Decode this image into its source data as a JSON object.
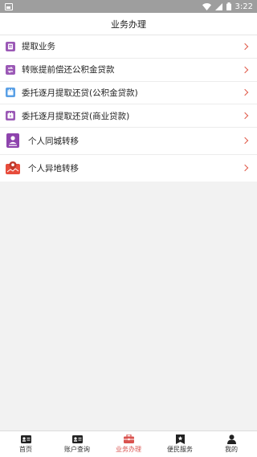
{
  "status_bar": {
    "time": "3:22"
  },
  "header": {
    "title": "业务办理"
  },
  "menu": [
    {
      "label": "提取业务",
      "icon": "withdraw-icon",
      "color": "#9b59b6"
    },
    {
      "label": "转账提前偿还公积金贷款",
      "icon": "transfer-repay-icon",
      "color": "#9b59b6"
    },
    {
      "label": "委托逐月提取还贷(公积金贷款)",
      "icon": "monthly-fund-icon",
      "color": "#5aa0e6"
    },
    {
      "label": "委托逐月提取还贷(商业贷款)",
      "icon": "monthly-commercial-icon",
      "color": "#9b59b6"
    },
    {
      "label": "个人同城转移",
      "icon": "same-city-icon",
      "color": "#8e44ad"
    },
    {
      "label": "个人异地转移",
      "icon": "other-city-icon",
      "color": "#e74c3c"
    }
  ],
  "bottom_nav": [
    {
      "label": "首页",
      "icon": "home-card-icon",
      "active": false
    },
    {
      "label": "账户查询",
      "icon": "account-card-icon",
      "active": false
    },
    {
      "label": "业务办理",
      "icon": "briefcase-icon",
      "active": true
    },
    {
      "label": "便民服务",
      "icon": "bookmark-icon",
      "active": false
    },
    {
      "label": "我的",
      "icon": "user-icon",
      "active": false
    }
  ],
  "colors": {
    "accent": "#d9534f",
    "chevron": "#e05a4a",
    "status_bar": "#9e9e9e"
  }
}
